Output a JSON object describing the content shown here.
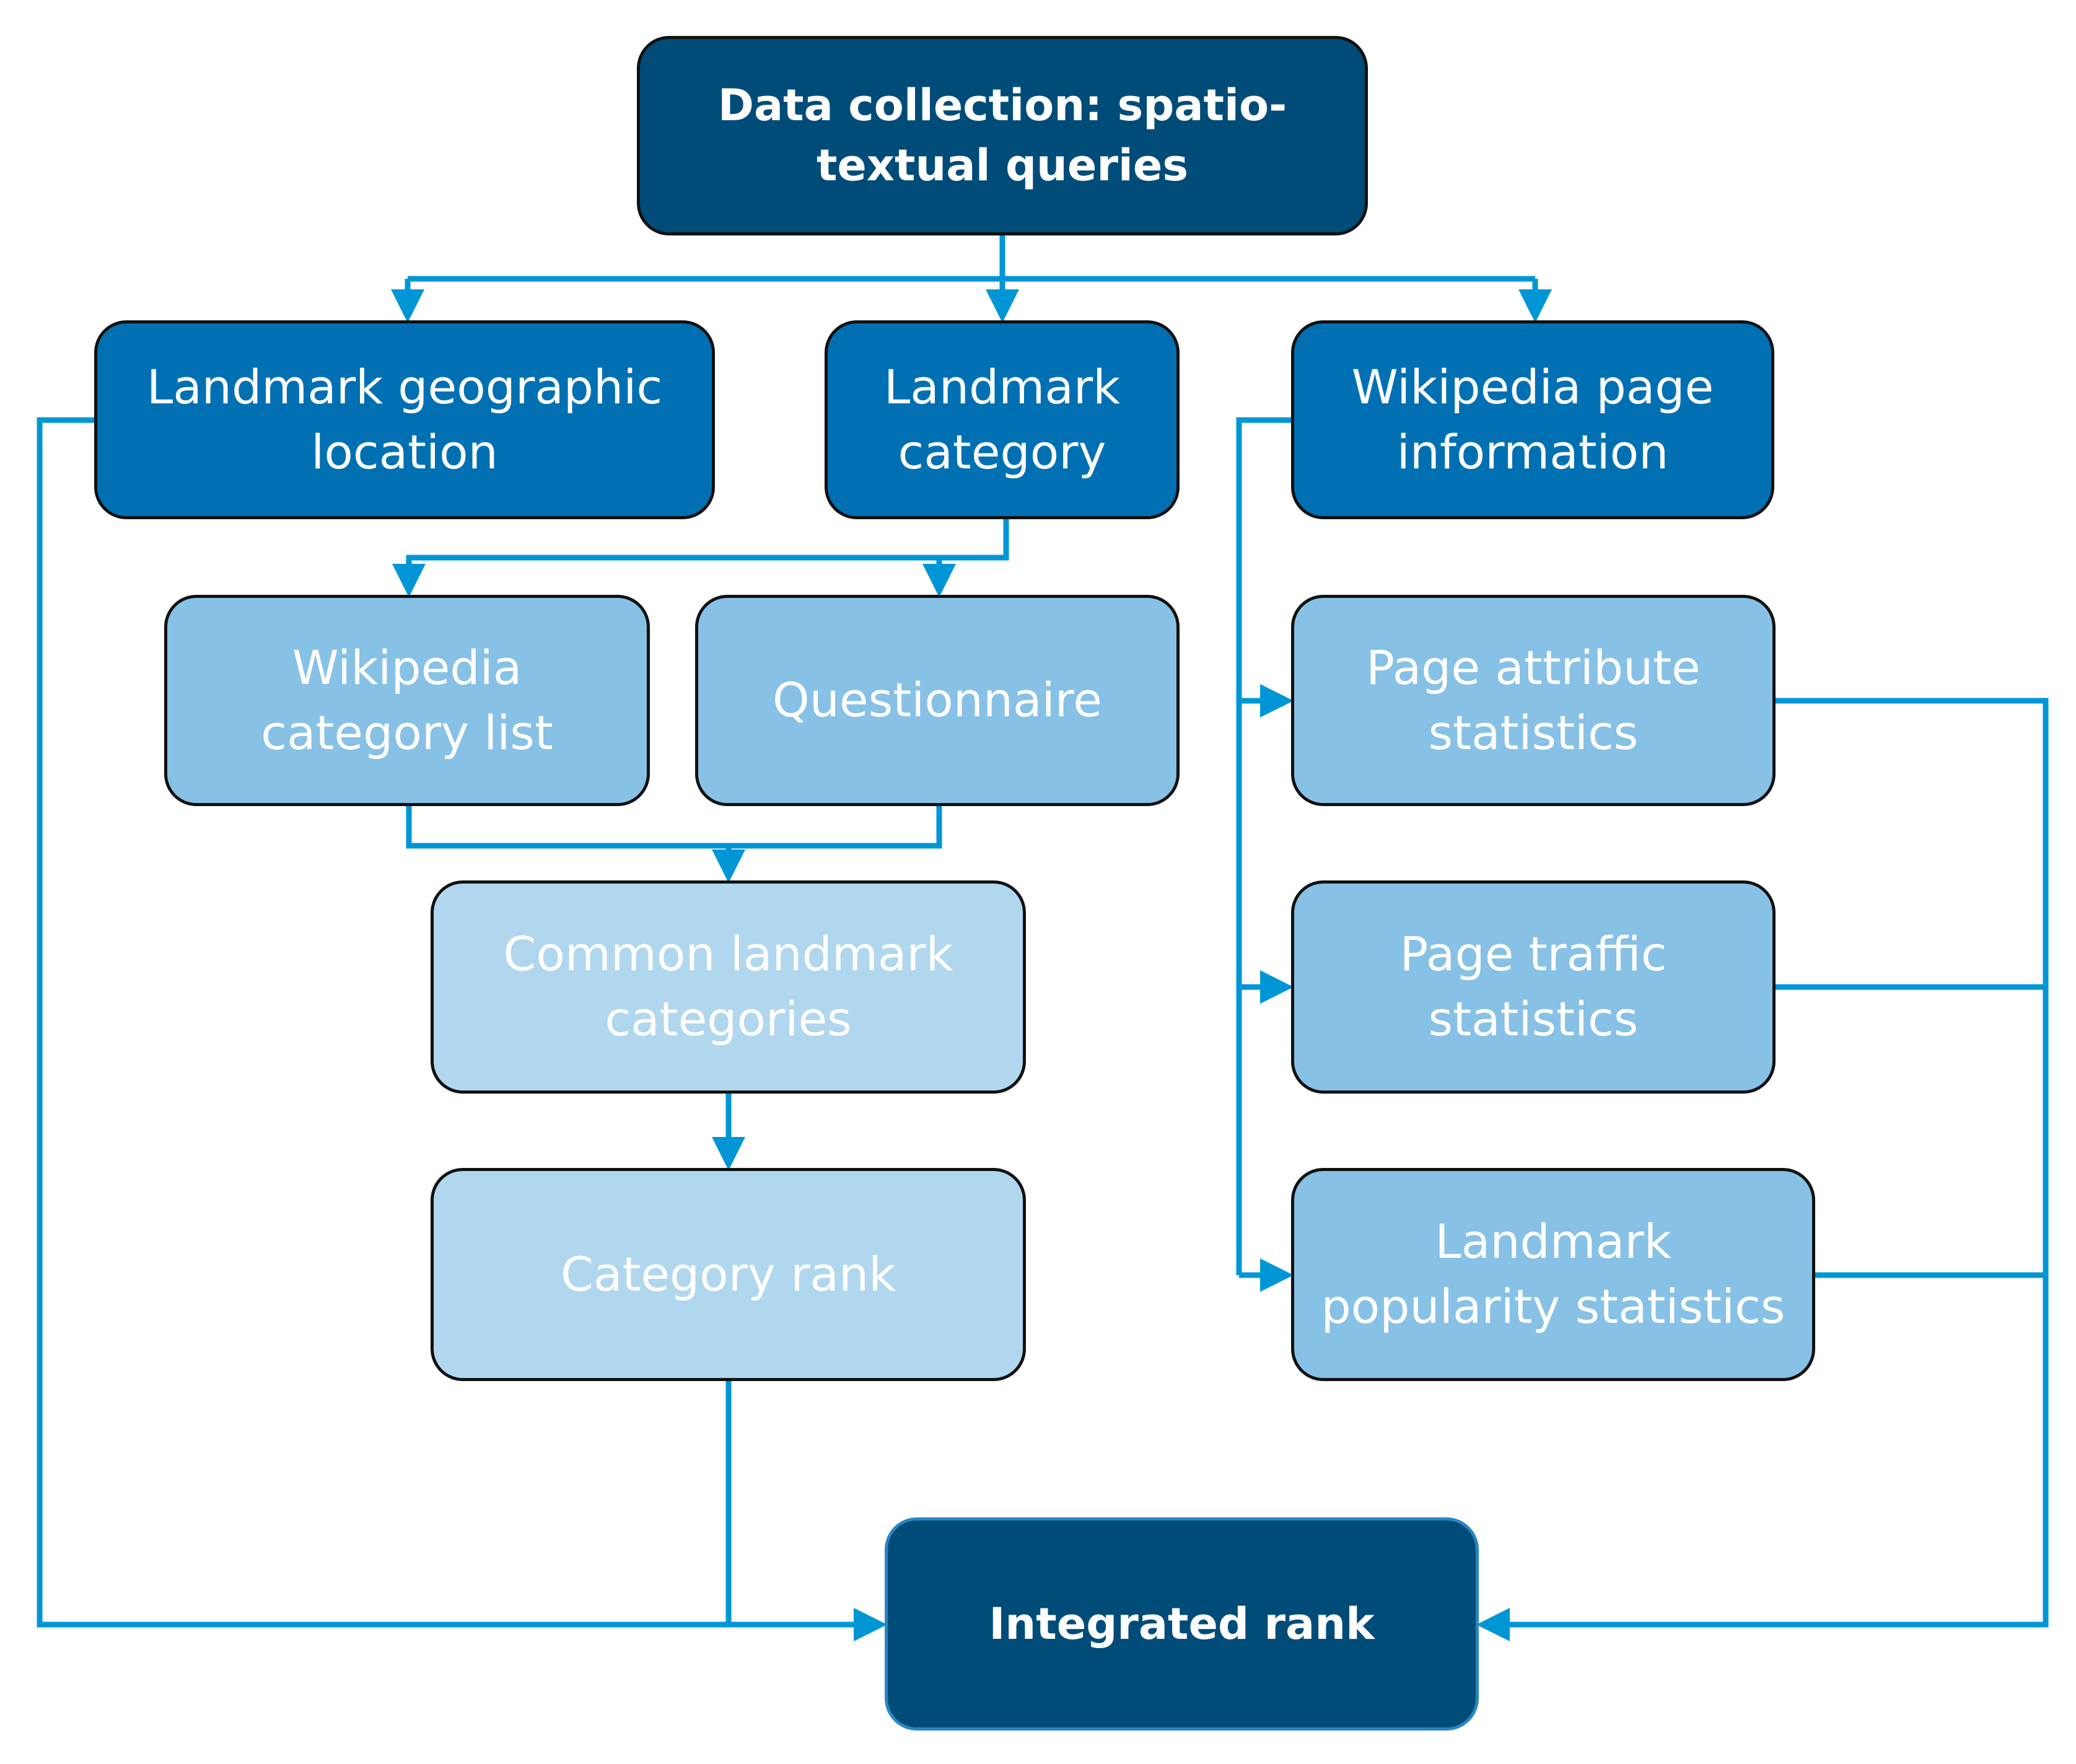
{
  "diagram": {
    "colors": {
      "level1": "#004C78",
      "level2": "#0070B3",
      "level3": "#87C1E5",
      "level4": "#B0D7EE",
      "connector": "#0096D6",
      "text": "#FFFFFF"
    },
    "nodes": {
      "data_collection": "Data collection: spatio-textual queries",
      "geo_location": "Landmark geographic location",
      "landmark_category": "Landmark category",
      "wiki_page_info": "Wikipedia page information",
      "wiki_category_list": "Wikipedia category list",
      "questionnaire": "Questionnaire",
      "common_categories": "Common landmark categories",
      "category_rank": "Category rank",
      "page_attribute_stats": "Page attribute statistics",
      "page_traffic_stats": "Page traffic statistics",
      "popularity_stats": "Landmark popularity statistics",
      "integrated_rank": "Integrated rank"
    },
    "edges": [
      {
        "from": "data_collection",
        "to": "geo_location"
      },
      {
        "from": "data_collection",
        "to": "landmark_category"
      },
      {
        "from": "data_collection",
        "to": "wiki_page_info"
      },
      {
        "from": "landmark_category",
        "to": "wiki_category_list"
      },
      {
        "from": "landmark_category",
        "to": "questionnaire"
      },
      {
        "from": "wiki_category_list",
        "to": "common_categories"
      },
      {
        "from": "questionnaire",
        "to": "common_categories"
      },
      {
        "from": "common_categories",
        "to": "category_rank"
      },
      {
        "from": "wiki_page_info",
        "to": "page_attribute_stats"
      },
      {
        "from": "wiki_page_info",
        "to": "page_traffic_stats"
      },
      {
        "from": "wiki_page_info",
        "to": "popularity_stats"
      },
      {
        "from": "geo_location",
        "to": "integrated_rank"
      },
      {
        "from": "category_rank",
        "to": "integrated_rank"
      },
      {
        "from": "page_attribute_stats",
        "to": "integrated_rank"
      },
      {
        "from": "page_traffic_stats",
        "to": "integrated_rank"
      },
      {
        "from": "popularity_stats",
        "to": "integrated_rank"
      }
    ]
  }
}
